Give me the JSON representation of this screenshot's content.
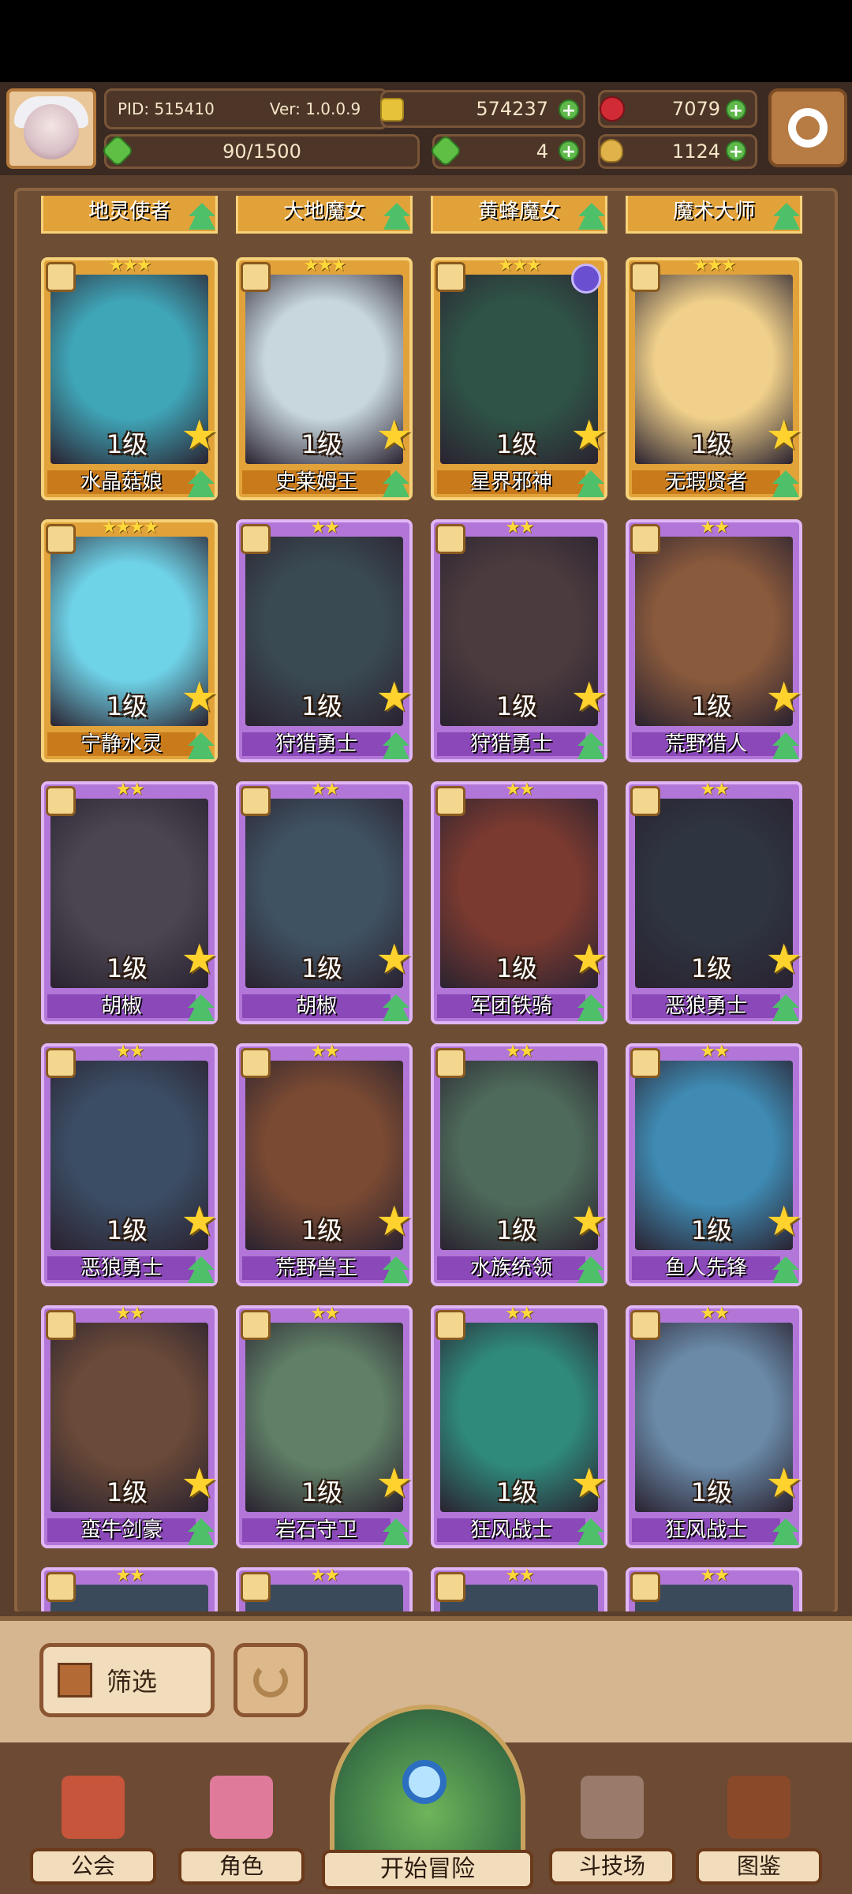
{
  "header": {
    "pid": "PID: 515410",
    "version": "Ver: 1.0.0.9",
    "stamina": "90/1500",
    "coins": "574237",
    "gems": "7079",
    "clover_count": "4",
    "bag_count": "1124"
  },
  "top_row": [
    "地灵使者",
    "大地魔女",
    "黄蜂魔女",
    "魔术大师"
  ],
  "cards": [
    {
      "name": "水晶菇娘",
      "level": "1级",
      "stars": "★★★",
      "rarity": "gold",
      "color": "#3fa6b8"
    },
    {
      "name": "史莱姆王",
      "level": "1级",
      "stars": "★★★",
      "rarity": "gold",
      "color": "#c8d7de"
    },
    {
      "name": "星界邪神",
      "level": "1级",
      "stars": "★★★",
      "rarity": "gold",
      "color": "#2f5447"
    },
    {
      "name": "无瑕贤者",
      "level": "1级",
      "stars": "★★★",
      "rarity": "gold",
      "color": "#f0d08a"
    },
    {
      "name": "宁静水灵",
      "level": "1级",
      "stars": "★★★★",
      "rarity": "gold",
      "color": "#6fd3e8"
    },
    {
      "name": "狩猎勇士",
      "level": "1级",
      "stars": "★★",
      "rarity": "purple",
      "color": "#3a4a52"
    },
    {
      "name": "狩猎勇士",
      "level": "1级",
      "stars": "★★",
      "rarity": "purple",
      "color": "#4b3b3e"
    },
    {
      "name": "荒野猎人",
      "level": "1级",
      "stars": "★★",
      "rarity": "purple",
      "color": "#8a5a3c"
    },
    {
      "name": "胡椒",
      "level": "1级",
      "stars": "★★",
      "rarity": "purple",
      "color": "#4a4550"
    },
    {
      "name": "胡椒",
      "level": "1级",
      "stars": "★★",
      "rarity": "purple",
      "color": "#3f5262"
    },
    {
      "name": "军团铁骑",
      "level": "1级",
      "stars": "★★",
      "rarity": "purple",
      "color": "#7a3a30"
    },
    {
      "name": "恶狼勇士",
      "level": "1级",
      "stars": "★★",
      "rarity": "purple",
      "color": "#2e3440"
    },
    {
      "name": "恶狼勇士",
      "level": "1级",
      "stars": "★★",
      "rarity": "purple",
      "color": "#3b4d64"
    },
    {
      "name": "荒野兽王",
      "level": "1级",
      "stars": "★★",
      "rarity": "purple",
      "color": "#7a4a32"
    },
    {
      "name": "水族统领",
      "level": "1级",
      "stars": "★★",
      "rarity": "purple",
      "color": "#4d6a5a"
    },
    {
      "name": "鱼人先锋",
      "level": "1级",
      "stars": "★★",
      "rarity": "purple",
      "color": "#3f8bb3"
    },
    {
      "name": "蛮牛剑豪",
      "level": "1级",
      "stars": "★★",
      "rarity": "purple",
      "color": "#6a4a38"
    },
    {
      "name": "岩石守卫",
      "level": "1级",
      "stars": "★★",
      "rarity": "purple",
      "color": "#5f7f66"
    },
    {
      "name": "狂风战士",
      "level": "1级",
      "stars": "★★",
      "rarity": "purple",
      "color": "#2f8a7c"
    },
    {
      "name": "狂风战士",
      "level": "1级",
      "stars": "★★",
      "rarity": "purple",
      "color": "#6a8aa8"
    }
  ],
  "partial_stars": [
    "★★",
    "★★",
    "★★",
    "★★"
  ],
  "filter": {
    "label": "筛选"
  },
  "nav": {
    "guild": "公会",
    "character": "角色",
    "adventure": "开始冒险",
    "arena": "斗技场",
    "codex": "图鉴"
  }
}
